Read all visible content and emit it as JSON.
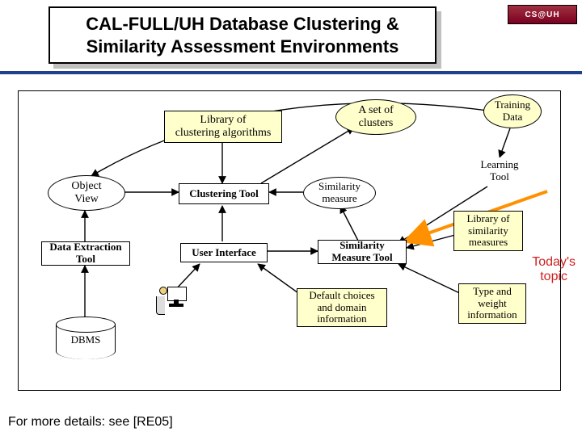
{
  "title_line1": "CAL-FULL/UH Database Clustering &",
  "title_line2": "Similarity Assessment Environments",
  "logo_text": "CS@UH",
  "footer": "For more details: see [RE05]",
  "todays_l1": "Today's",
  "todays_l2": "topic",
  "nodes": {
    "lib_cluster_l1": "Library of",
    "lib_cluster_l2": "clustering algorithms",
    "set_clusters_l1": "A set of",
    "set_clusters_l2": "clusters",
    "training_l1": "Training",
    "training_l2": "Data",
    "learning_l1": "Learning",
    "learning_l2": "Tool",
    "object_view_l1": "Object",
    "object_view_l2": "View",
    "clustering_tool": "Clustering Tool",
    "similarity_measure_l1": "Similarity",
    "similarity_measure_l2": "measure",
    "data_extraction_l1": "Data Extraction",
    "data_extraction_l2": "Tool",
    "user_interface": "User Interface",
    "sim_measure_tool_l1": "Similarity",
    "sim_measure_tool_l2": "Measure Tool",
    "lib_sim_l1": "Library of",
    "lib_sim_l2": "similarity",
    "lib_sim_l3": "measures",
    "default_l1": "Default choices",
    "default_l2": "and domain",
    "default_l3": "information",
    "type_weight_l1": "Type and",
    "type_weight_l2": "weight",
    "type_weight_l3": "information",
    "dbms": "DBMS"
  }
}
